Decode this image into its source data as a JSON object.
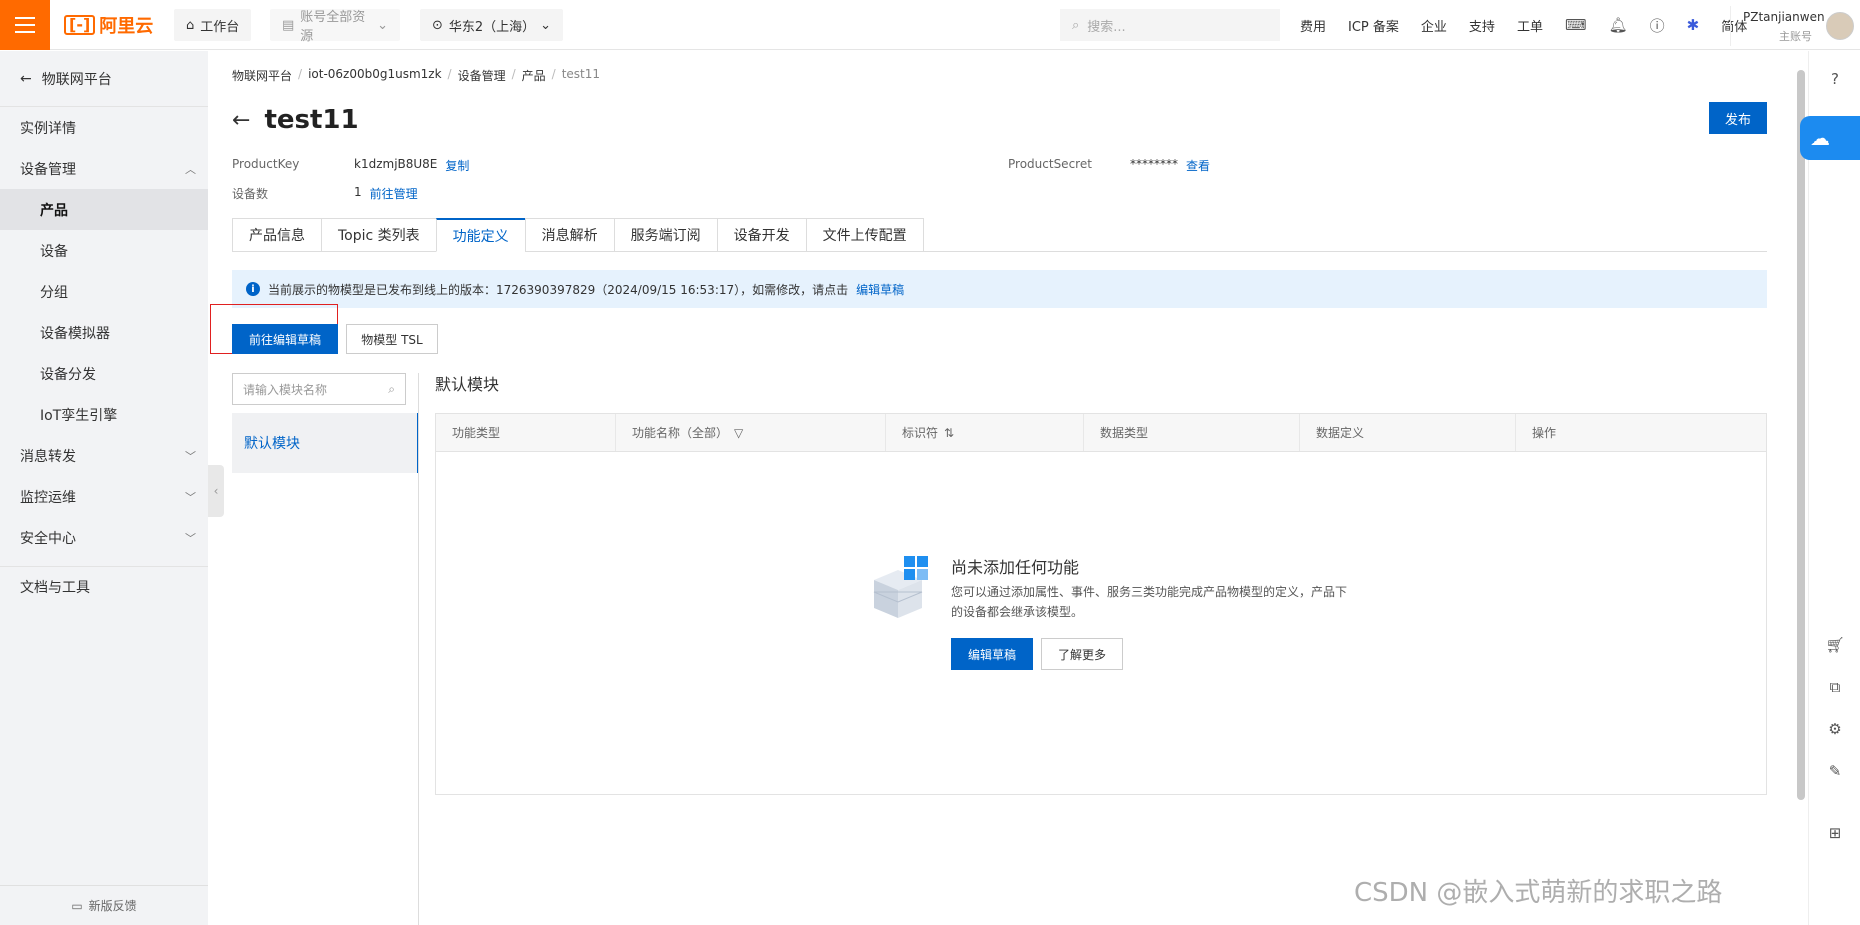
{
  "topbar": {
    "logo_text": "阿里云",
    "workbench": "工作台",
    "resource_scope": "账号全部资源",
    "region": "华东2（上海）",
    "search_placeholder": "搜索...",
    "links": [
      "费用",
      "ICP 备案",
      "企业",
      "支持",
      "工单"
    ],
    "lang": "简体",
    "user_name": "PZtanjianwen",
    "user_role": "主账号"
  },
  "sidebar": {
    "back_label": "物联网平台",
    "items": [
      {
        "label": "实例详情"
      },
      {
        "label": "设备管理"
      },
      {
        "label": "产品"
      },
      {
        "label": "设备"
      },
      {
        "label": "分组"
      },
      {
        "label": "设备模拟器"
      },
      {
        "label": "设备分发"
      },
      {
        "label": "IoT孪生引擎"
      },
      {
        "label": "消息转发"
      },
      {
        "label": "监控运维"
      },
      {
        "label": "安全中心"
      },
      {
        "label": "文档与工具"
      }
    ],
    "footer": "新版反馈"
  },
  "breadcrumb": [
    "物联网平台",
    "iot-06z00b0g1usm1zk",
    "设备管理",
    "产品",
    "test11"
  ],
  "page": {
    "title": "test11",
    "publish_label": "发布",
    "product_key_label": "ProductKey",
    "product_key_value": "k1dzmjB8U8E",
    "copy_label": "复制",
    "product_secret_label": "ProductSecret",
    "product_secret_value": "********",
    "view_label": "查看",
    "device_count_label": "设备数",
    "device_count_value": "1",
    "manage_label": "前往管理"
  },
  "tabs": [
    "产品信息",
    "Topic 类列表",
    "功能定义",
    "消息解析",
    "服务端订阅",
    "设备开发",
    "文件上传配置"
  ],
  "notice": {
    "text": "当前展示的物模型是已发布到线上的版本：1726390397829（2024/09/15 16:53:17），如需修改，请点击",
    "link": "编辑草稿"
  },
  "actions": {
    "edit_draft": "前往编辑草稿",
    "tsl": "物模型 TSL"
  },
  "modules": {
    "search_placeholder": "请输入模块名称",
    "items": [
      "默认模块"
    ],
    "section_title": "默认模块"
  },
  "table": {
    "headers": [
      "功能类型",
      "功能名称（全部）",
      "标识符",
      "数据类型",
      "数据定义",
      "操作"
    ]
  },
  "empty": {
    "title": "尚未添加任何功能",
    "desc": "您可以通过添加属性、事件、服务三类功能完成产品物模型的定义，产品下的设备都会继承该模型。",
    "btn_primary": "编辑草稿",
    "btn_secondary": "了解更多"
  },
  "watermark": "CSDN @嵌入式萌新的求职之路",
  "colors": {
    "brand": "#ff6a00",
    "primary": "#0064c8",
    "notice_bg": "#e6f2fd"
  }
}
